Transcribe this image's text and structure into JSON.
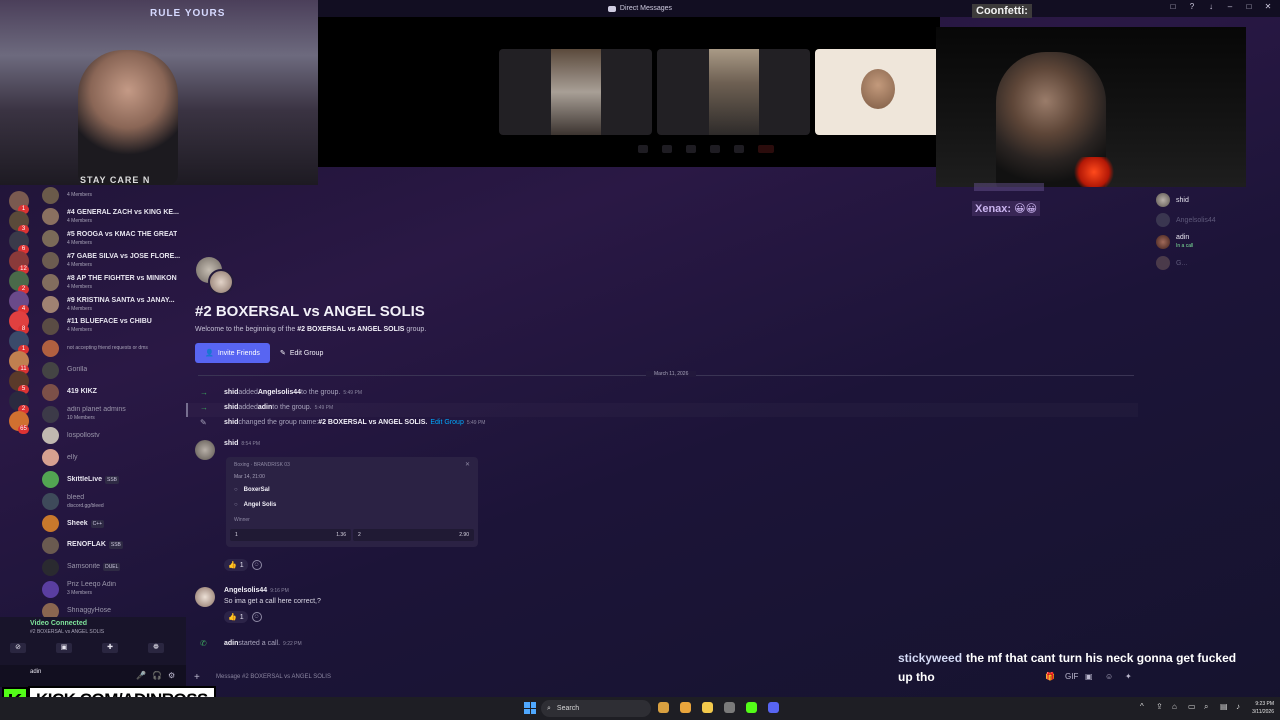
{
  "window": {
    "title": "Direct Messages",
    "controls": [
      "□",
      "?",
      "↓",
      "–",
      "□",
      "✕"
    ]
  },
  "overlay": {
    "confetti_label": "Coonfetti:",
    "xenax_label": "Xenax:",
    "xenax_emotes": "😀😀",
    "webcam1_neon": "RULE YOURS",
    "webcam1_shirt": "STAY CARE N"
  },
  "call": {
    "controls": [
      "mic",
      "camera",
      "share",
      "activities",
      "soundboard",
      "hangup"
    ]
  },
  "server_badges": [
    "1",
    "3",
    "6",
    "12",
    "2",
    "4",
    "8",
    "1",
    "11",
    "5",
    "2",
    "65"
  ],
  "dm_list": [
    {
      "name": "",
      "sub": "4 Members",
      "color": "#6a5a4a"
    },
    {
      "name": "#4 GENERAL ZACH vs KING KE...",
      "sub": "4 Members",
      "color": "#8a7060"
    },
    {
      "name": "#5 ROOGA vs KMAC THE GREAT",
      "sub": "4 Members",
      "color": "#7a6a58"
    },
    {
      "name": "#7 GABE SILVA vs JOSE FLORE...",
      "sub": "4 Members",
      "color": "#6c5c50"
    },
    {
      "name": "#8 AP THE FIGHTER vs MINIKON",
      "sub": "4 Members",
      "color": "#826d5e"
    },
    {
      "name": "#9 KRISTINA SANTA vs JANAY...",
      "sub": "4 Members",
      "color": "#a08272"
    },
    {
      "name": "#11 BLUEFACE vs CHIBU",
      "sub": "4 Members",
      "color": "#5a4c44"
    },
    {
      "name": "",
      "sub": "not accepting friend requests or dms",
      "color": "#b06040"
    },
    {
      "name": "Gorilla",
      "sub": "",
      "color": "#444",
      "dim": true
    },
    {
      "name": "419 KIKZ",
      "sub": "",
      "color": "#7c5048"
    },
    {
      "name": "adin planet admins",
      "sub": "10 Members",
      "color": "#3c3a48",
      "dim": true
    },
    {
      "name": "lospollostv",
      "sub": "",
      "color": "#c0b8b0",
      "dim": true
    },
    {
      "name": "elly",
      "sub": "",
      "color": "#d6a090",
      "dim": true
    },
    {
      "name": "SkittleLive",
      "sub": "",
      "tag": "SSB",
      "color": "#52a452"
    },
    {
      "name": "bleed",
      "sub": "discord.gg/bleed",
      "color": "#3e4a5a",
      "dim": true
    },
    {
      "name": "Sheek",
      "sub": "",
      "tag": "C++",
      "color": "#c8782c"
    },
    {
      "name": "RENOFLAK",
      "sub": "",
      "tag": "SSB",
      "color": "#6a5a50"
    },
    {
      "name": "Samsonite",
      "sub": "",
      "tag": "DUEL",
      "color": "#2a2a30",
      "dim": true
    },
    {
      "name": "Priz Leeqo Adin",
      "sub": "3 Members",
      "color": "#5a3ea0",
      "dim": true
    },
    {
      "name": "ShnaggyHose",
      "sub": "",
      "color": "#8a6650",
      "dim": true
    }
  ],
  "voice": {
    "status": "Video Connected",
    "channel": "#2 BOXERSAL vs ANGEL SOLIS",
    "buttons": [
      "⊘",
      "▣",
      "✚",
      "❁"
    ],
    "user": "adin",
    "user_icons": [
      "🎤",
      "🎧",
      "⚙"
    ]
  },
  "kick": {
    "logo": "K",
    "text": "KICK.COM/ADINROSS"
  },
  "group": {
    "title": "#2 BOXERSAL vs ANGEL SOLIS",
    "welcome_prefix": "Welcome to the beginning of the ",
    "welcome_name": "#2 BOXERSAL vs ANGEL SOLIS",
    "welcome_suffix": " group.",
    "invite_label": "Invite Friends",
    "edit_label": "Edit Group",
    "date": "March 11, 2026"
  },
  "system_messages": [
    {
      "actor": "shid",
      "text": " added ",
      "target": "Angelsolis44",
      "after": " to the group.",
      "time": "5:49 PM"
    },
    {
      "actor": "shid",
      "text": " added ",
      "target": "adin",
      "after": " to the group.",
      "time": "5:49 PM"
    },
    {
      "actor": "shid",
      "text": " changed the group name: ",
      "target": "#2 BOXERSAL vs ANGEL SOLIS.",
      "after": "",
      "link": "Edit Group",
      "time": "5:49 PM"
    }
  ],
  "messages": [
    {
      "author": "shid",
      "time": "8:54 PM"
    },
    {
      "author": "Angelsolis44",
      "time": "9:16 PM",
      "text": "So ima get a call here correct,?"
    }
  ],
  "bet_card": {
    "header": "Boxing · BRANDRISK 03",
    "date": "Mar 14, 21:00",
    "option1": "BoxerSal",
    "option2": "Angel Solis",
    "market": "Winner",
    "odds": [
      {
        "label": "1",
        "value": "1.36"
      },
      {
        "label": "2",
        "value": "2.90"
      }
    ],
    "close": "✕"
  },
  "reactions": [
    {
      "emoji": "👍",
      "count": "1"
    },
    {
      "emoji": "👍",
      "count": "1"
    }
  ],
  "call_started": {
    "actor": "adin",
    "text": " started a call.",
    "time": "9:22 PM"
  },
  "composer": {
    "placeholder": "Message #2 BOXERSAL vs ANGEL SOLIS",
    "icons": [
      "🎁",
      "GIF",
      "▣",
      "☺",
      "✦"
    ]
  },
  "members": [
    {
      "name": "shid",
      "sub": "",
      "dim": false
    },
    {
      "name": "Angelsolis44",
      "sub": "",
      "dim": true
    },
    {
      "name": "adin",
      "sub": "In a call",
      "dim": false
    },
    {
      "name": "G...",
      "sub": "",
      "dim": true
    }
  ],
  "stream_chat": {
    "user": "stickyweed",
    "message": "the mf that cant turn his neck gonna get fucked up tho"
  },
  "taskbar": {
    "search": "Search",
    "apps_colors": [
      "#d8a040",
      "#e9a53c",
      "#f2c94c",
      "#7a7a7a",
      "#53fc18",
      "#5865f2"
    ],
    "tray": [
      "^",
      "⇪",
      "⌂",
      "▭",
      "⌕",
      "▤",
      "♪"
    ],
    "time": "9:23 PM",
    "date": "3/11/2026"
  }
}
